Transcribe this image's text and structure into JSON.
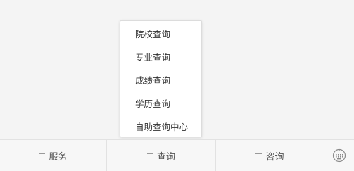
{
  "popup_menu": {
    "items": [
      {
        "label": "院校查询"
      },
      {
        "label": "专业查询"
      },
      {
        "label": "成绩查询"
      },
      {
        "label": "学历查询"
      },
      {
        "label": "自助查询中心"
      }
    ]
  },
  "bottom_bar": {
    "tabs": [
      {
        "label": "服务",
        "icon": "menu-icon"
      },
      {
        "label": "查询",
        "icon": "menu-icon"
      },
      {
        "label": "咨询",
        "icon": "menu-icon"
      }
    ],
    "keyboard_icon": "keyboard-icon"
  },
  "colors": {
    "background": "#f4f4f4",
    "menu_text": "#333333",
    "tab_text": "#555555",
    "divider": "#e2e2e2"
  }
}
